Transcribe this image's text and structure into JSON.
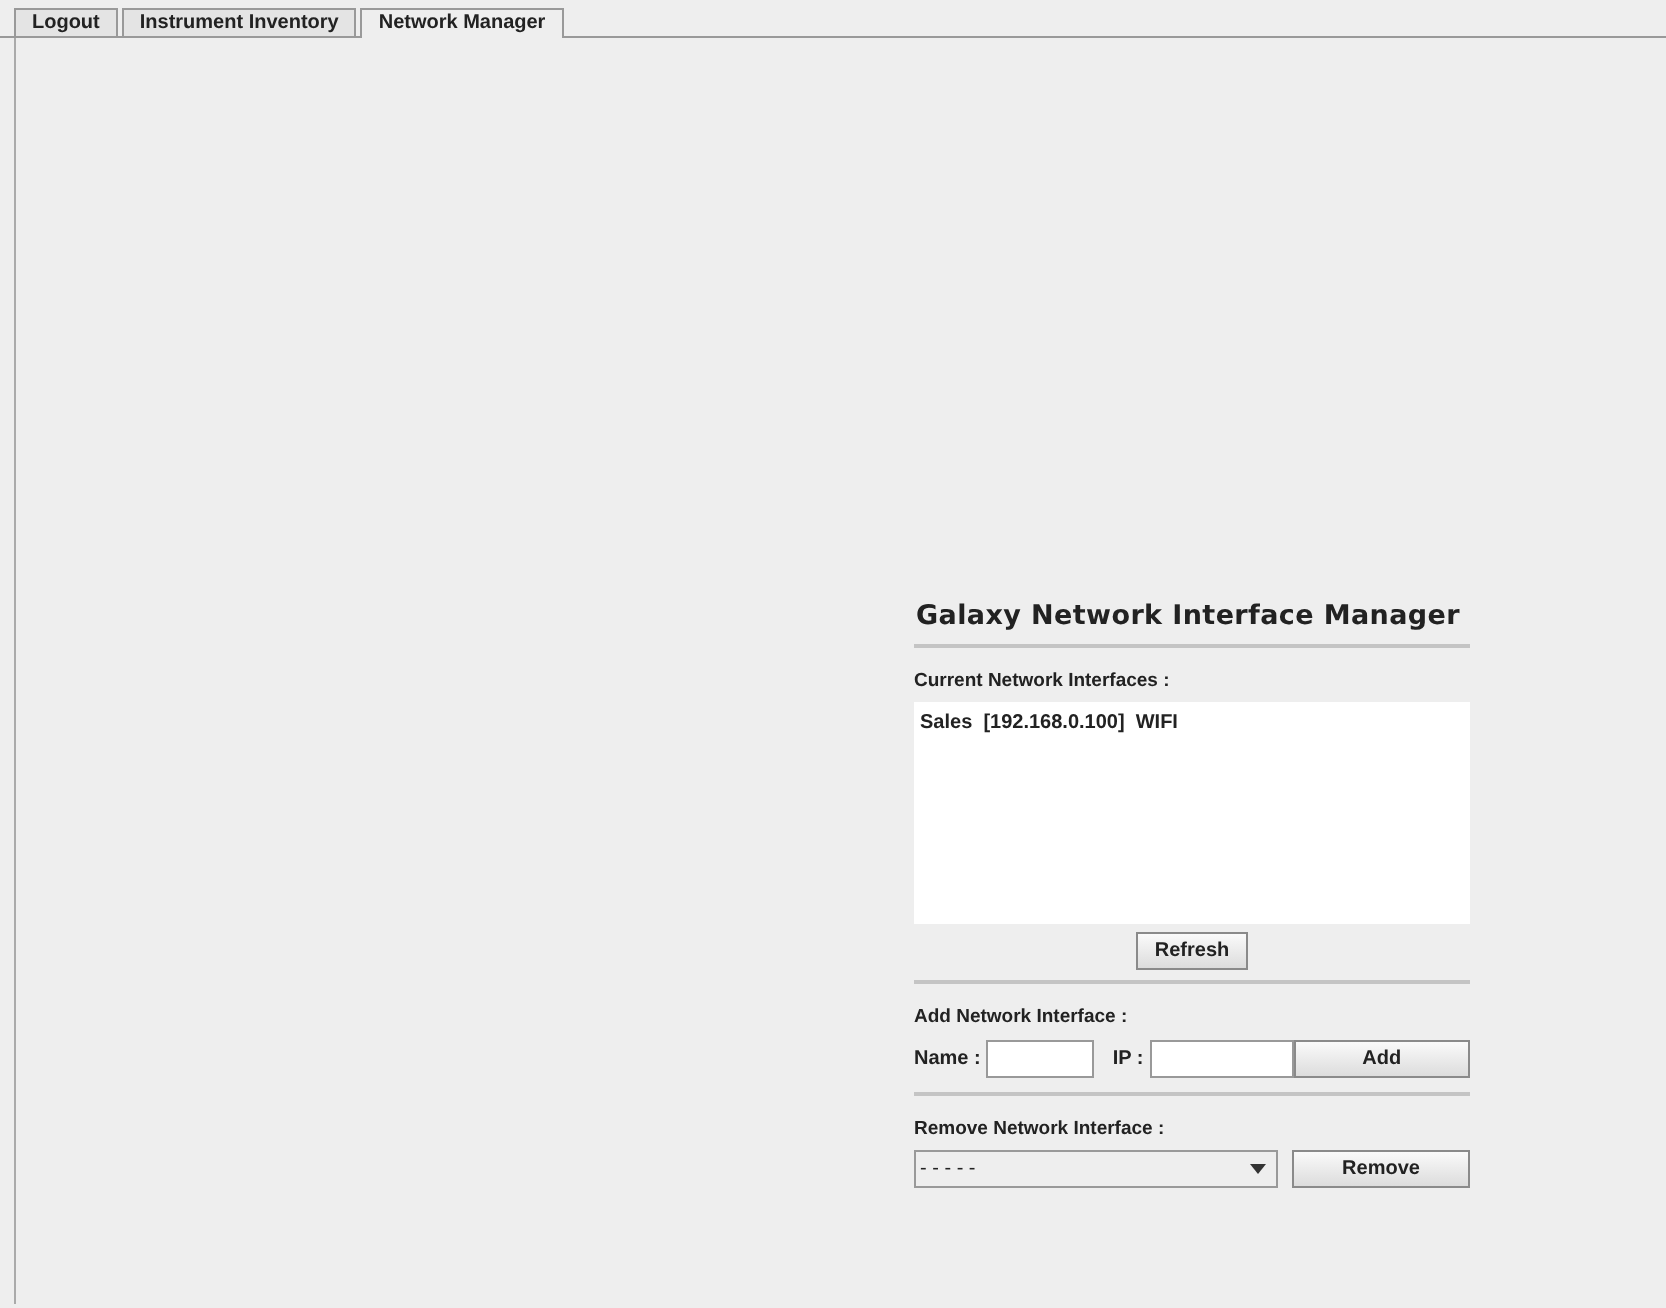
{
  "tabs": [
    {
      "label": "Logout",
      "selected": false
    },
    {
      "label": "Instrument Inventory",
      "selected": false
    },
    {
      "label": "Network Manager",
      "selected": true
    }
  ],
  "panel": {
    "title": "Galaxy Network Interface Manager",
    "current_label": "Current Network Interfaces :",
    "interfaces": [
      {
        "name": "Sales",
        "ip": "[192.168.0.100]",
        "type": "WIFI"
      }
    ],
    "refresh_button": "Refresh",
    "add_label": "Add Network Interface :",
    "name_label": "Name :",
    "ip_label": "IP :",
    "add_button": "Add",
    "remove_label": "Remove Network Interface :",
    "remove_select": "- - - - -",
    "remove_button": "Remove"
  }
}
